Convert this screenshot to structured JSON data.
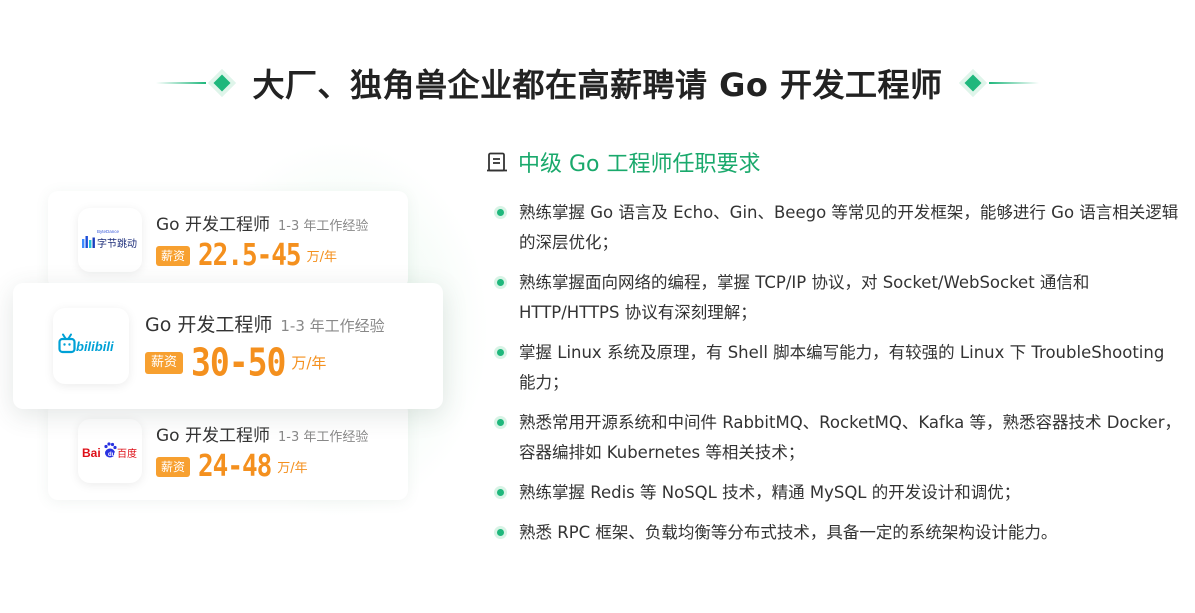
{
  "headline": {
    "title": "大厂、独角兽企业都在高薪聘请 Go 开发工程师"
  },
  "jobs": [
    {
      "company": "ByteDance",
      "logo_label": "字节跳动",
      "logo_sub": "ByteDance",
      "title": "Go 开发工程师",
      "experience": "1-3 年工作经验",
      "badge": "薪资",
      "salary": "22.5-45",
      "unit": "万/年"
    },
    {
      "company": "bilibili",
      "logo_label": "bilibili",
      "title": "Go 开发工程师",
      "experience": "1-3 年工作经验",
      "badge": "薪资",
      "salary": "30-50",
      "unit": "万/年"
    },
    {
      "company": "Baidu",
      "logo_label_en": "Bai",
      "logo_label_cn": "百度",
      "title": "Go 开发工程师",
      "experience": "1-3 年工作经验",
      "badge": "薪资",
      "salary": "24-48",
      "unit": "万/年"
    }
  ],
  "requirements": {
    "title": "中级 Go 工程师任职要求",
    "items": [
      "熟练掌握 Go 语言及 Echo、Gin、Beego 等常见的开发框架，能够进行 Go 语言相关逻辑的深层优化；",
      "熟练掌握面向网络的编程，掌握 TCP/IP 协议，对 Socket/WebSocket 通信和 HTTP/HTTPS 协议有深刻理解；",
      "掌握 Linux 系统及原理，有 Shell 脚本编写能力，有较强的 Linux 下 TroubleShooting 能力；",
      "熟悉常用开源系统和中间件 RabbitMQ、RocketMQ、Kafka 等，熟悉容器技术 Docker，容器编排如 Kubernetes 等相关技术；",
      "熟练掌握 Redis 等 NoSQL 技术，精通 MySQL 的开发设计和调优；",
      "熟悉 RPC 框架、负载均衡等分布式技术，具备一定的系统架构设计能力。"
    ]
  },
  "colors": {
    "accent_green": "#1fb77c",
    "title_green": "#1aa96c",
    "salary_orange": "#f4901e",
    "badge_orange": "#f7a030",
    "bilibili_blue": "#00a1d6",
    "baidu_red": "#de0f17",
    "baidu_blue": "#2932e1"
  },
  "icons": {
    "document": "doc-icon",
    "bullet": "dot-icon"
  }
}
